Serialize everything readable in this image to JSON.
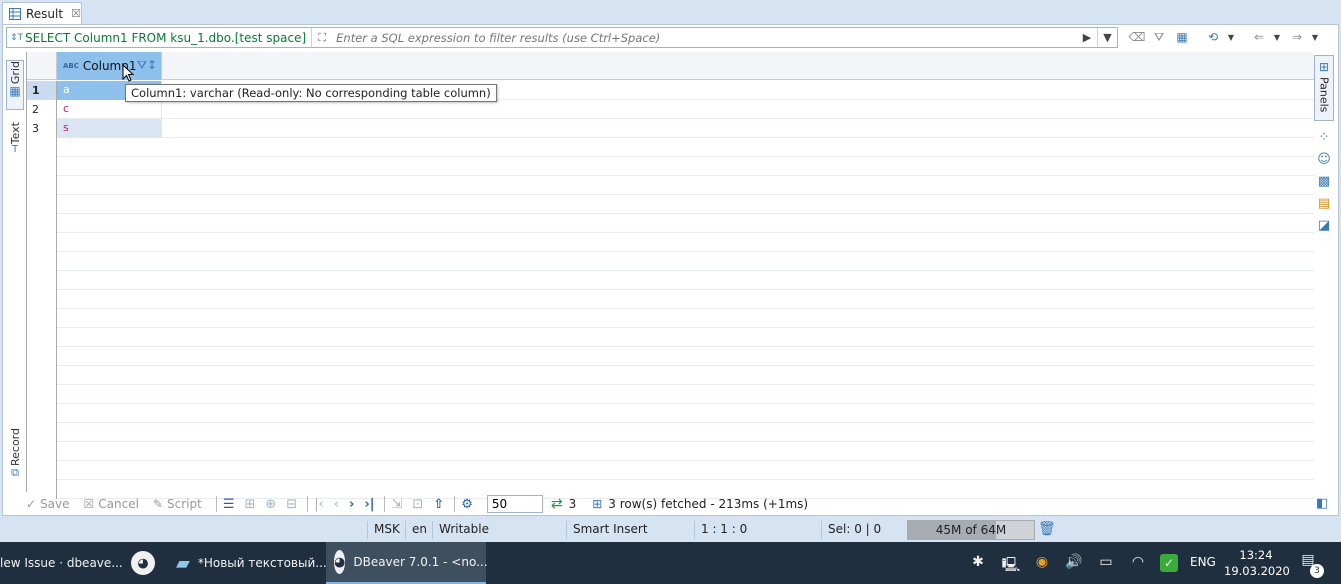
{
  "tab": {
    "title": "Result",
    "close_glyph": "☒"
  },
  "filter": {
    "sql": "SELECT Column1 FROM ksu_1.dbo.[test space]",
    "placeholder": "Enter a SQL expression to filter results (use Ctrl+Space)"
  },
  "left_tabs": {
    "grid": "Grid",
    "text": "Text",
    "record": "Record"
  },
  "grid": {
    "columns": [
      {
        "name": "Column1",
        "type_badge": "ABC"
      }
    ],
    "rows": [
      {
        "num": "1",
        "value": "a"
      },
      {
        "num": "2",
        "value": "c"
      },
      {
        "num": "3",
        "value": "s"
      }
    ],
    "tooltip": "Column1: varchar (Read-only: No corresponding table column)"
  },
  "right_panel": {
    "label": "Panels"
  },
  "bottom": {
    "save": "Save",
    "cancel": "Cancel",
    "script": "Script",
    "fetch_size": "50",
    "row_count": "3",
    "status": "3 row(s) fetched - 213ms (+1ms)"
  },
  "statusbar": {
    "timezone": "MSK",
    "locale": "en",
    "mode": "Writable",
    "insert": "Smart Insert",
    "position": "1 : 1 : 0",
    "selection": "Sel: 0 | 0",
    "heap": "45M of 64M",
    "heap_used_fraction": 0.7
  },
  "taskbar": {
    "items": [
      {
        "label": "lew Issue · dbeave..."
      },
      {
        "label": ""
      },
      {
        "label": "*Новый текстовый..."
      },
      {
        "label": "DBeaver 7.0.1 - <no..."
      }
    ],
    "language": "ENG",
    "time": "13:24",
    "date": "19.03.2020",
    "notifications": "3"
  }
}
